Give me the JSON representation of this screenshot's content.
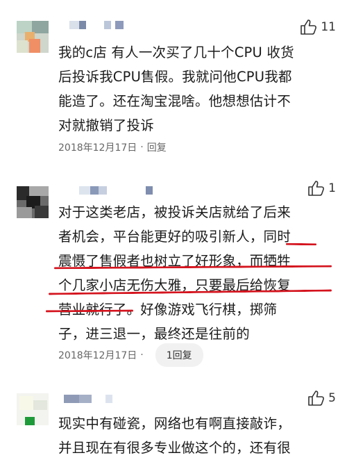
{
  "comments": [
    {
      "likes": "11",
      "lines": [
        "我的c店 有人一次买了几十个CPU 收货",
        "后投诉我CPU售假。我就问他CPU我都",
        "能造了。还在淘宝混啥。他想想估计不",
        "对就撤销了投诉"
      ],
      "date": "2018年12月17日",
      "separator": "·",
      "reply": "回复"
    },
    {
      "likes": "1",
      "lines": [
        "对于这类老店，被投诉关店就给了后来",
        "者机会，平台能更好的吸引新人，同时",
        "震慑了售假者也树立了好形象，而牺牲",
        "个几家小店无伤大雅，只要最后给恢复",
        "营业就行了。好像游戏飞行棋，掷筛",
        "子，进三退一，最终还是往前的"
      ],
      "date": "2018年12月17日",
      "separator": "·",
      "reply": "1回复"
    },
    {
      "likes": "5",
      "lines": [
        "现实中有碰瓷，网络也有啊直接敲诈，",
        "并且现在有很多专业做这个的，还有很"
      ]
    }
  ],
  "colors": {
    "annotation": "#d4141e",
    "meta_text": "#666666",
    "reply_pill_bg": "#f1f1f1"
  }
}
